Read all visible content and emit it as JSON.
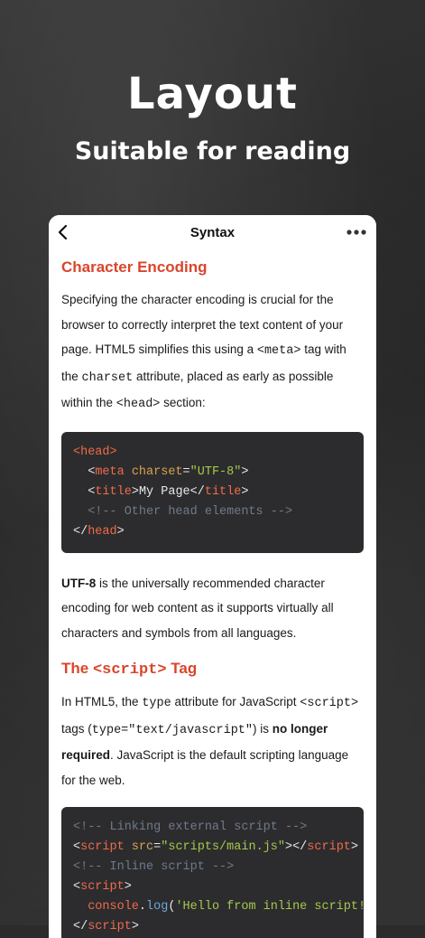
{
  "hero": {
    "title": "Layout",
    "subtitle": "Suitable for reading"
  },
  "nav": {
    "title": "Syntax",
    "back_icon": "chevron-left-icon",
    "more_icon": "more-horizontal-icon"
  },
  "section1": {
    "heading": "Character Encoding",
    "para1": {
      "t1": "Specifying the character encoding is crucial for the browser to correctly interpret the text content of your page. HTML5 simplifies this using a ",
      "c1": "<meta>",
      "t2": " tag with the ",
      "c2": "charset",
      "t3": " attribute, placed as early as possible within the ",
      "c3": "<head>",
      "t4": " section:"
    },
    "code": {
      "l1": {
        "o": "<",
        "tag": "head",
        "c": ">"
      },
      "l2": {
        "indent": "  ",
        "o": "<",
        "tag": "meta",
        "sp": " ",
        "attr": "charset",
        "eq": "=",
        "val": "\"UTF-8\"",
        "c": ">"
      },
      "l3": {
        "indent": "  ",
        "o": "<",
        "tag": "title",
        "c": ">",
        "text": "My Page",
        "o2": "</",
        "tag2": "title",
        "c2": ">"
      },
      "l4": {
        "indent": "  ",
        "comment": "<!-- Other head elements -->"
      },
      "l5": {
        "o": "</",
        "tag": "head",
        "c": ">"
      }
    },
    "para2": {
      "bold": "UTF-8",
      "text": " is the universally recommended character encoding for web content as it supports virtually all characters and symbols from all languages."
    }
  },
  "section2": {
    "heading_prefix": "The ",
    "heading_code": "<script>",
    "heading_suffix": " Tag",
    "para1": {
      "t1": "In HTML5, the ",
      "c1": "type",
      "t2": " attribute for JavaScript ",
      "c2": "<script>",
      "t3": " tags (",
      "c3": "type=\"text/javascript\"",
      "t4": ") is ",
      "b1": "no longer required",
      "t5": ". JavaScript is the default scripting language for the web."
    },
    "code": {
      "l1": {
        "comment": "<!-- Linking external script -->"
      },
      "l2": {
        "o": "<",
        "tag": "script",
        "sp": " ",
        "attr": "src",
        "eq": "=",
        "val": "\"scripts/main.js\"",
        "c": "></",
        "tag2": "script",
        "c2": ">"
      },
      "l3": {
        "comment": "<!-- Inline script -->"
      },
      "l4": {
        "o": "<",
        "tag": "script",
        "c": ">"
      },
      "l5": {
        "indent": "  ",
        "obj": "console",
        "dot": ".",
        "fn": "log",
        "p1": "(",
        "str": "'Hello from inline script!"
      },
      "l6": {
        "o": "</",
        "tag": "script",
        "c": ">"
      }
    }
  },
  "colors": {
    "heading": "#d9452b",
    "code_bg": "#2c2c2e",
    "tag": "#f06a4a",
    "attr": "#d9a350",
    "string": "#a5c94b",
    "comment": "#6f7a8a"
  }
}
